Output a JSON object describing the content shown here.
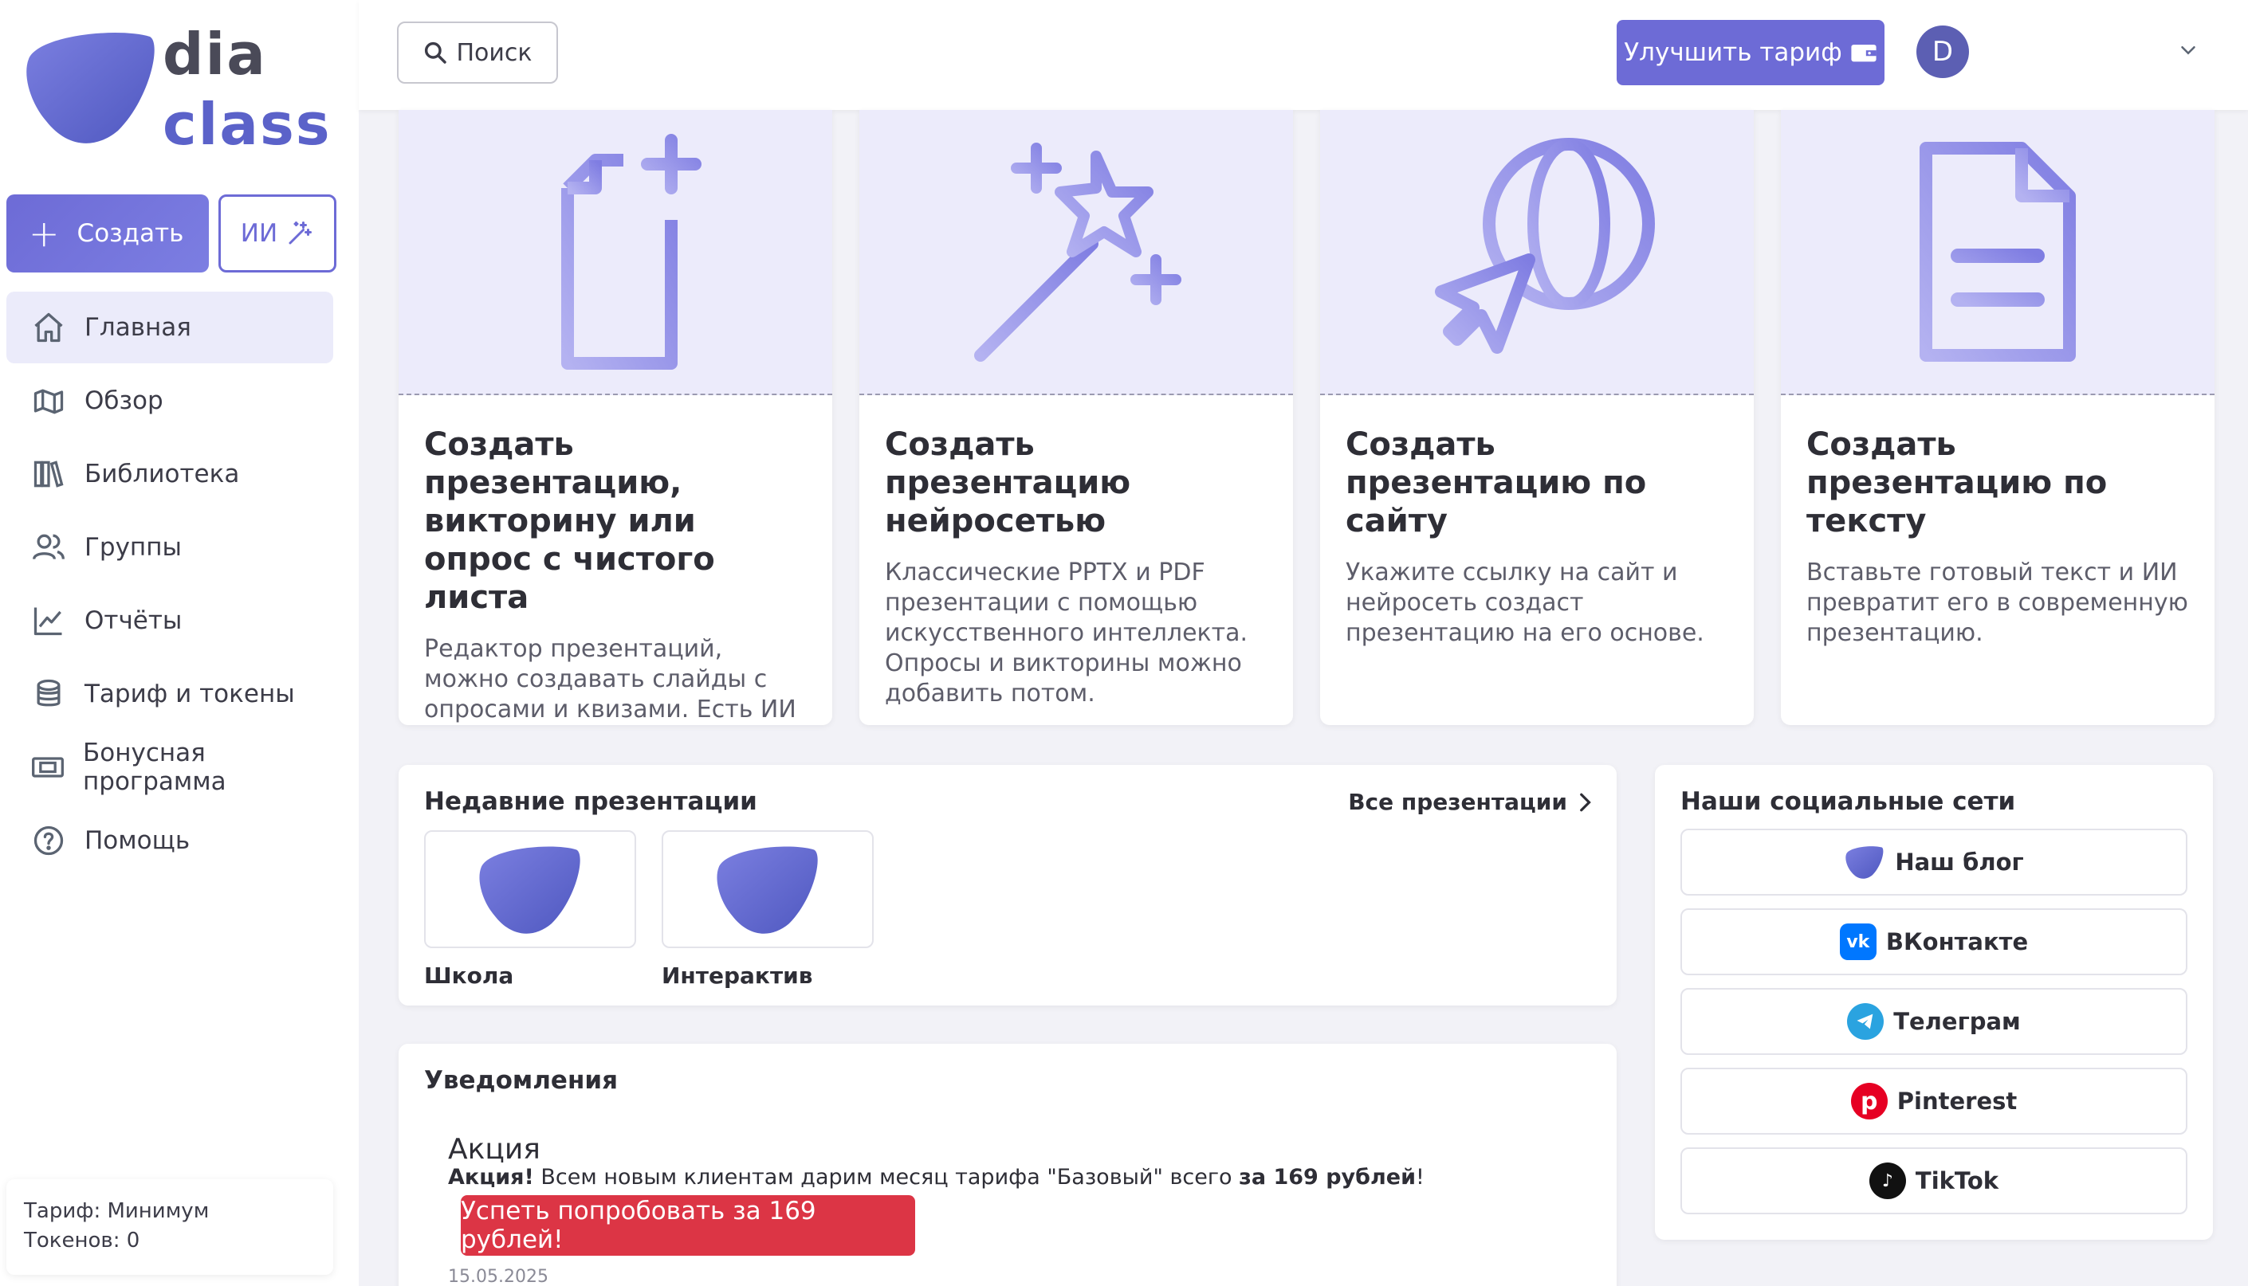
{
  "brand": {
    "line1": "dia",
    "line2": "class"
  },
  "sidebar": {
    "create_label": "Создать",
    "ai_label": "ИИ",
    "items": [
      {
        "label": "Главная",
        "icon": "home-icon"
      },
      {
        "label": "Обзор",
        "icon": "map-icon"
      },
      {
        "label": "Библиотека",
        "icon": "books-icon"
      },
      {
        "label": "Группы",
        "icon": "users-icon"
      },
      {
        "label": "Отчёты",
        "icon": "chart-icon"
      },
      {
        "label": "Тариф и токены",
        "icon": "coins-icon"
      },
      {
        "label": "Бонусная программа",
        "icon": "ticket-icon"
      },
      {
        "label": "Помощь",
        "icon": "help-icon"
      }
    ],
    "tariff_line": "Тариф: Минимум",
    "tokens_line": "Токенов: 0"
  },
  "topbar": {
    "search_label": "Поиск",
    "upgrade_label": "Улучшить тариф",
    "avatar_letter": "D"
  },
  "cards": [
    {
      "title": "Создать презентацию, викторину или опрос с чистого листа",
      "desc": "Редактор презентаций, можно создавать слайды с опросами и квизами. Есть ИИ помощники."
    },
    {
      "title": "Создать презентацию нейросетью",
      "desc": "Классические PPTX и PDF презентации с помощью искусственного интеллекта. Опросы и викторины можно добавить потом."
    },
    {
      "title": "Создать презентацию по сайту",
      "desc": "Укажите ссылку на сайт и нейросеть создаст презентацию на его основе."
    },
    {
      "title": "Создать презентацию по тексту",
      "desc": "Вставьте готовый текст и ИИ превратит его в современную презентацию."
    }
  ],
  "recent": {
    "title": "Недавние презентации",
    "all_link": "Все презентации",
    "items": [
      {
        "label": "Школа"
      },
      {
        "label": "Интерактив"
      }
    ]
  },
  "notifications": {
    "title": "Уведомления",
    "item_title": "Акция",
    "text_bold": "Акция!",
    "text_main": " Всем новым клиентам дарим месяц тарифа \"Базовый\" всего ",
    "text_price": "за 169 рублей",
    "text_end": "!",
    "button_label": "Успеть попробовать за 169 рублей!",
    "date": "15.05.2025"
  },
  "social": {
    "title": "Наши социальные сети",
    "items": [
      {
        "label": "Наш блог",
        "icon": "diaclass-icon"
      },
      {
        "label": "ВКонтакте",
        "icon": "vk-icon"
      },
      {
        "label": "Телеграм",
        "icon": "telegram-icon"
      },
      {
        "label": "Pinterest",
        "icon": "pinterest-icon"
      },
      {
        "label": "TikTok",
        "icon": "tiktok-icon"
      }
    ]
  },
  "colors": {
    "accent": "#6d6bd6",
    "promo": "#dc3545",
    "card_art_bg": "#ecebfb"
  }
}
